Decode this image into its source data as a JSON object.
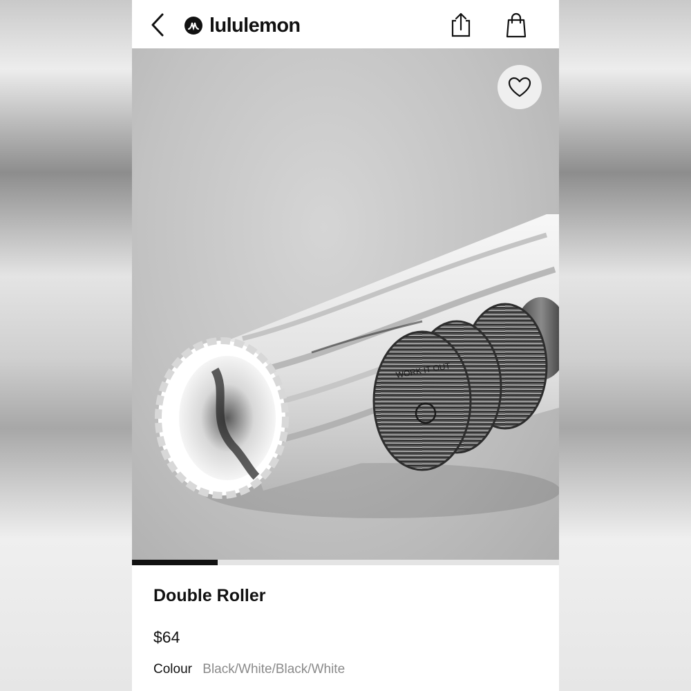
{
  "header": {
    "brand_name": "lululemon",
    "icons": {
      "back": "chevron-left-icon",
      "share": "share-icon",
      "bag": "shopping-bag-icon",
      "logo": "lululemon-logo-icon"
    }
  },
  "gallery": {
    "favorite_icon": "heart-icon",
    "progress_fraction": 0.2,
    "colors": {
      "progress_fill": "#111111",
      "progress_track": "#e4e4e4"
    }
  },
  "product": {
    "title": "Double Roller",
    "price": "$64",
    "colour_label": "Colour",
    "colour_value": "Black/White/Black/White",
    "image_label": "WORK IT OUT"
  }
}
